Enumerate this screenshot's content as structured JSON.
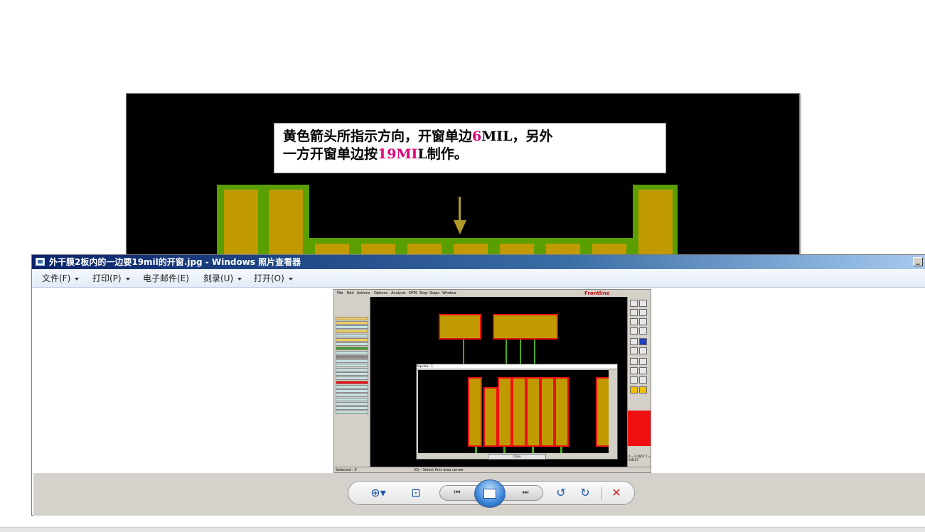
{
  "background_image": {
    "note_line1_a": "黄色箭头所指示方向，开窗单边",
    "note_line1_hl": "6",
    "note_line1_b": "MIL，另外",
    "note_line2_a": "一方开窗单边按",
    "note_line2_hl": "19MI",
    "note_line2_b": "L制作。"
  },
  "viewer": {
    "title": "外干膜2板内的一边要19mil的开窗.jpg - Windows 照片查看器",
    "minimize_label": "_",
    "menu": [
      {
        "label": "文件(F)"
      },
      {
        "label": "打印(P)"
      },
      {
        "label": "电子邮件(E)"
      },
      {
        "label": "刻录(U)"
      },
      {
        "label": "打开(O)"
      }
    ],
    "controls": {
      "zoom": "⊕▾",
      "fit": "⊡",
      "prev": "⏮",
      "next": "⏭",
      "rotate_ccw": "↺",
      "rotate_cw": "↻",
      "delete": "✕"
    }
  },
  "embedded": {
    "menu": [
      "File",
      "Edit",
      "Actions",
      "Options",
      "Analysis",
      "DFM",
      "Step",
      "Steps",
      "Window"
    ],
    "brand": "Frontline",
    "popup_title": "Popview - 1",
    "popup_close": "Close",
    "status": "Selected : 0",
    "status_hint": "(O) - Select first area corner",
    "coords": "X = 0.0857  Y = 0.8167"
  },
  "colors": {
    "pad": "#c09a00",
    "soldermask_green": "#5a9e00",
    "copper_outline": "#ee1010",
    "titlebar": "#0a246a"
  }
}
